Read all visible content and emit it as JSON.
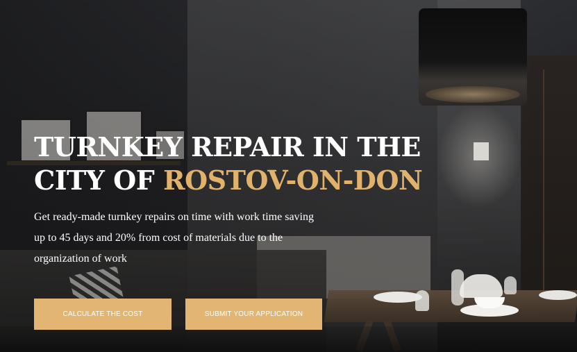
{
  "hero": {
    "title_line1": "TURNKEY REPAIR IN THE",
    "title_line2_prefix": "CITY OF ",
    "title_line2_accent": "ROSTOV-ON-DON",
    "subtitle_line1": "Get ready-made turnkey repairs on time with work time saving",
    "subtitle_line2": "up to 45 days and 20% from cost of materials due to the",
    "subtitle_line3": "organization of work"
  },
  "actions": {
    "calculate_label": "CALCULATE THE COST",
    "submit_label": "SUBMIT YOUR APPLICATION"
  },
  "colors": {
    "accent": "#e1b26b",
    "button_bg": "#e2b672",
    "text": "#ffffff"
  }
}
